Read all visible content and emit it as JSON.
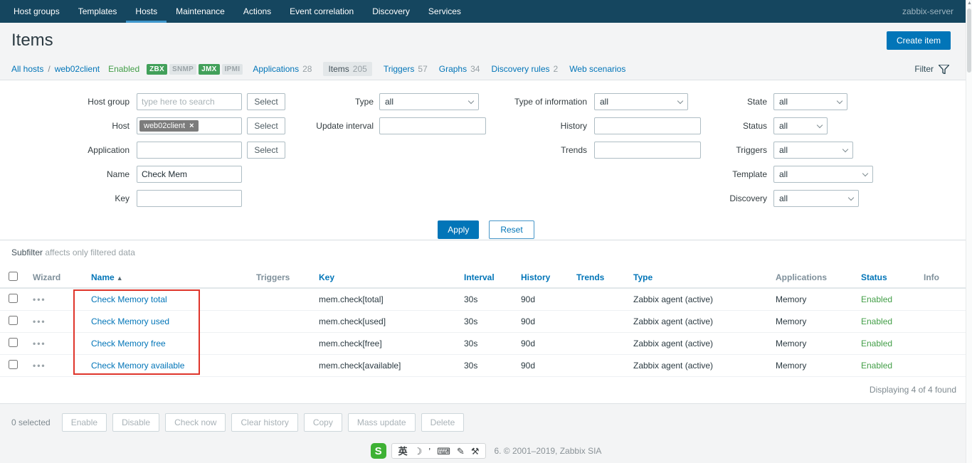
{
  "colors": {
    "accent": "#0275b8",
    "nav_background": "#15465f",
    "status_green": "#429e47",
    "badge_green": "#42a05a",
    "annotation_red": "#df352b"
  },
  "nav": {
    "items": [
      {
        "label": "Host groups"
      },
      {
        "label": "Templates"
      },
      {
        "label": "Hosts"
      },
      {
        "label": "Maintenance"
      },
      {
        "label": "Actions"
      },
      {
        "label": "Event correlation"
      },
      {
        "label": "Discovery"
      },
      {
        "label": "Services"
      }
    ],
    "server": "zabbix-server"
  },
  "header": {
    "title": "Items",
    "create_button": "Create item"
  },
  "hostbar": {
    "all_hosts": "All hosts",
    "separator": "/",
    "host": "web02client",
    "status": "Enabled",
    "badges": [
      {
        "label": "ZBX"
      },
      {
        "label": "SNMP"
      },
      {
        "label": "JMX"
      },
      {
        "label": "IPMI"
      }
    ],
    "tabs": [
      {
        "label": "Applications",
        "count": "28"
      },
      {
        "label": "Items",
        "count": "205"
      },
      {
        "label": "Triggers",
        "count": "57"
      },
      {
        "label": "Graphs",
        "count": "34"
      },
      {
        "label": "Discovery rules",
        "count": "2"
      },
      {
        "label": "Web scenarios",
        "count": ""
      }
    ],
    "filter_label": "Filter"
  },
  "filter": {
    "select_button": "Select",
    "host_group_label": "Host group",
    "host_group_placeholder": "type here to search",
    "host_label": "Host",
    "host_chip": "web02client",
    "host_chip_remove": "×",
    "application_label": "Application",
    "name_label": "Name",
    "name_value": "Check Mem",
    "key_label": "Key",
    "type_label": "Type",
    "type_value": "all",
    "update_interval_label": "Update interval",
    "info_label": "Type of information",
    "info_value": "all",
    "history_label": "History",
    "trends_label": "Trends",
    "state_label": "State",
    "state_value": "all",
    "status_label": "Status",
    "status_value": "all",
    "triggers_label": "Triggers",
    "triggers_value": "all",
    "template_label": "Template",
    "template_value": "all",
    "discovery_label": "Discovery",
    "discovery_value": "all",
    "apply_button": "Apply",
    "reset_button": "Reset"
  },
  "subfilter": {
    "title": "Subfilter",
    "note": " affects only filtered data"
  },
  "table": {
    "headers": {
      "wizard": "Wizard",
      "name": "Name",
      "sort_indicator": "▲",
      "triggers": "Triggers",
      "key": "Key",
      "interval": "Interval",
      "history": "History",
      "trends": "Trends",
      "type": "Type",
      "applications": "Applications",
      "status": "Status",
      "info": "Info"
    },
    "wizard_icon": "•••",
    "rows": [
      {
        "name": "Check Memory total",
        "key": "mem.check[total]",
        "interval": "30s",
        "history": "90d",
        "trends": "",
        "type": "Zabbix agent (active)",
        "applications": "Memory",
        "status": "Enabled"
      },
      {
        "name": "Check Memory used",
        "key": "mem.check[used]",
        "interval": "30s",
        "history": "90d",
        "trends": "",
        "type": "Zabbix agent (active)",
        "applications": "Memory",
        "status": "Enabled"
      },
      {
        "name": "Check Memory free",
        "key": "mem.check[free]",
        "interval": "30s",
        "history": "90d",
        "trends": "",
        "type": "Zabbix agent (active)",
        "applications": "Memory",
        "status": "Enabled"
      },
      {
        "name": "Check Memory available",
        "key": "mem.check[available]",
        "interval": "30s",
        "history": "90d",
        "trends": "",
        "type": "Zabbix agent (active)",
        "applications": "Memory",
        "status": "Enabled"
      }
    ],
    "summary": "Displaying 4 of 4 found"
  },
  "actionbar": {
    "selected": "0 selected",
    "buttons": [
      {
        "label": "Enable"
      },
      {
        "label": "Disable"
      },
      {
        "label": "Check now"
      },
      {
        "label": "Clear history"
      },
      {
        "label": "Copy"
      },
      {
        "label": "Mass update"
      },
      {
        "label": "Delete"
      }
    ]
  },
  "footer": {
    "ime_logo": "S",
    "ime_lang": "英",
    "ime_moon": "☽",
    "ime_punct": "’",
    "ime_keyboard": "⌨",
    "ime_pen": "✎",
    "ime_wrench": "⚒",
    "copyright": "6. © 2001–2019, Zabbix SIA"
  }
}
